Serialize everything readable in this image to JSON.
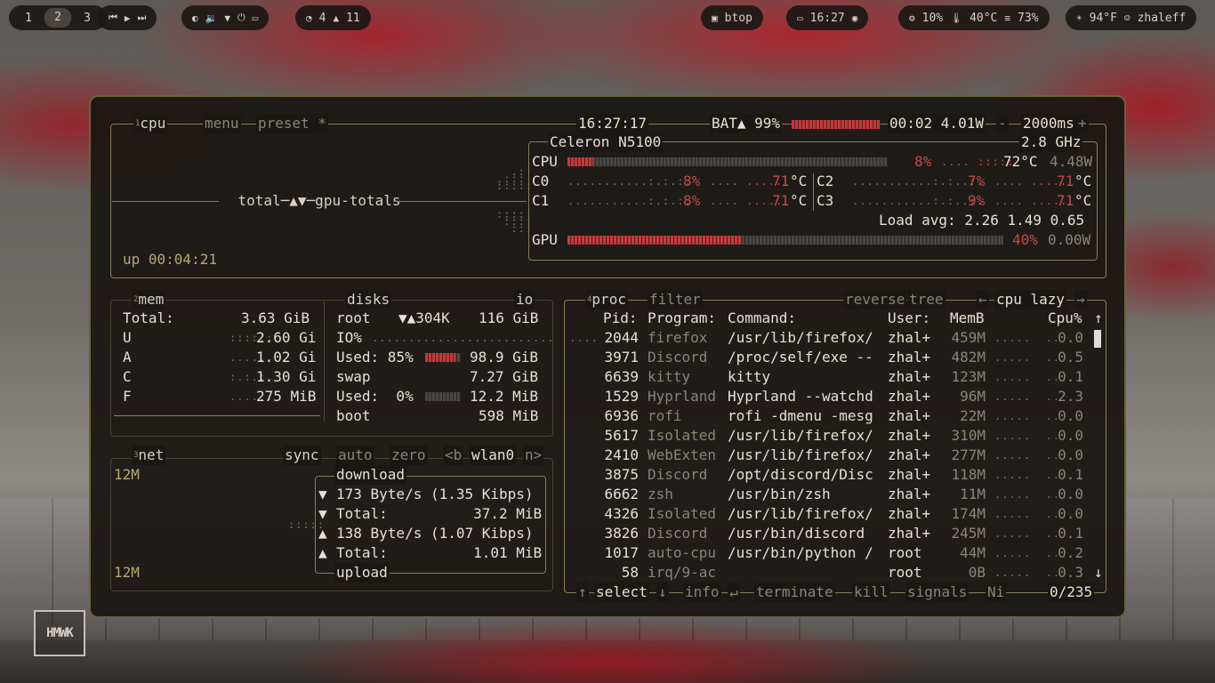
{
  "topbar": {
    "workspaces": [
      "1",
      "2",
      "3"
    ],
    "media_icons": [
      "prev-icon",
      "play-icon",
      "next-icon"
    ],
    "system_icons": [
      "brightness-icon",
      "volume-icon",
      "wifi-icon",
      "power-icon",
      "battery-icon"
    ],
    "counters": {
      "a": "4",
      "b": "11"
    },
    "window_title": "btop",
    "clock": "16:27",
    "cpu": "10%",
    "temp": "40°C",
    "disk": "73%",
    "weather": "94°F",
    "user": "zhaleff"
  },
  "cpu_box": {
    "title": "cpu",
    "num": "1",
    "menu": "menu",
    "preset": "preset *",
    "time": "16:27:17",
    "battery": "BAT▲ 99%",
    "battery_level": 0.99,
    "battery_time": "00:02 4.01W",
    "interval": "2000ms",
    "graph_label": "total─▲▼─gpu-totals",
    "uptime": "up 00:04:21",
    "model": "Celeron N5100",
    "freq": "2.8 GHz",
    "cpu_label": "CPU",
    "cpu_pct": "8%",
    "cpu_temp": "72°C",
    "cpu_power": "4.48W",
    "cpu_level": 0.08,
    "cores": [
      {
        "name": "C0",
        "pct": "8%",
        "temp": "71",
        "unit": "°C"
      },
      {
        "name": "C1",
        "pct": "8%",
        "temp": "71",
        "unit": "°C"
      },
      {
        "name": "C2",
        "pct": "7%",
        "temp": "71",
        "unit": "°C"
      },
      {
        "name": "C3",
        "pct": "9%",
        "temp": "71",
        "unit": "°C"
      }
    ],
    "load": "Load avg: 2.26 1.49 0.65",
    "gpu_label": "GPU",
    "gpu_pct": "40%",
    "gpu_power": "0.00W",
    "gpu_level": 0.4
  },
  "mem_box": {
    "title": "mem",
    "num": "2",
    "rows": [
      {
        "label": "Total:",
        "value": "3.63 GiB"
      },
      {
        "label": "U",
        "value": "2.60 Gi"
      },
      {
        "label": "A",
        "value": "1.02 Gi"
      },
      {
        "label": "C",
        "value": "1.30 Gi"
      },
      {
        "label": "F",
        "value": "275 MiB"
      }
    ],
    "disks_title": "disks",
    "io": "io",
    "disks": [
      {
        "name": "root",
        "io": "▼▲304K",
        "size": "116 GiB"
      },
      {
        "name": "swap",
        "size": "7.27 GiB"
      },
      {
        "name": "boot",
        "size": "598 MiB"
      }
    ],
    "io_pct": "IO%",
    "root_used": "Used: 85%",
    "root_used_level": 0.85,
    "root_used_size": "98.9 GiB",
    "swap_used": "Used:  0%",
    "swap_used_level": 0.0,
    "swap_used_size": "12.2 MiB"
  },
  "net_box": {
    "title": "net",
    "num": "3",
    "sync": "sync",
    "auto": "auto",
    "zero": "zero",
    "prev": "<b",
    "iface": "wlan0",
    "next": "n>",
    "scale_top": "12M",
    "scale_bottom": "12M",
    "download": "download",
    "upload": "upload",
    "rows": [
      {
        "arrow": "▼",
        "text": "173 Byte/s (1.35 Kibps)"
      },
      {
        "arrow": "▼",
        "text": "Total:          37.2 MiB"
      },
      {
        "arrow": "▲",
        "text": "138 Byte/s (1.07 Kibps)"
      },
      {
        "arrow": "▲",
        "text": "Total:          1.01 MiB"
      }
    ]
  },
  "proc_box": {
    "title": "proc",
    "num": "4",
    "filter": "filter",
    "reverse": "reverse",
    "tree": "tree",
    "sort": "cpu lazy",
    "headers": {
      "pid": "Pid:",
      "program": "Program:",
      "command": "Command:",
      "user": "User:",
      "mem": "MemB",
      "cpu": "Cpu%"
    },
    "rows": [
      {
        "pid": "2044",
        "program": "firefox",
        "command": "/usr/lib/firefox/",
        "user": "zhal+",
        "mem": "459M",
        "cpu": "0.0"
      },
      {
        "pid": "3971",
        "program": "Discord",
        "command": "/proc/self/exe --",
        "user": "zhal+",
        "mem": "482M",
        "cpu": "0.5"
      },
      {
        "pid": "6639",
        "program": "kitty",
        "command": "kitty",
        "user": "zhal+",
        "mem": "123M",
        "cpu": "0.1"
      },
      {
        "pid": "1529",
        "program": "Hyprland",
        "command": "Hyprland --watchd",
        "user": "zhal+",
        "mem": "96M",
        "cpu": "2.3"
      },
      {
        "pid": "6936",
        "program": "rofi",
        "command": "rofi -dmenu -mesg",
        "user": "zhal+",
        "mem": "22M",
        "cpu": "0.0"
      },
      {
        "pid": "5617",
        "program": "Isolated",
        "command": "/usr/lib/firefox/",
        "user": "zhal+",
        "mem": "310M",
        "cpu": "0.0"
      },
      {
        "pid": "2410",
        "program": "WebExten",
        "command": "/usr/lib/firefox/",
        "user": "zhal+",
        "mem": "277M",
        "cpu": "0.0"
      },
      {
        "pid": "3875",
        "program": "Discord",
        "command": "/opt/discord/Disc",
        "user": "zhal+",
        "mem": "118M",
        "cpu": "0.1"
      },
      {
        "pid": "6662",
        "program": "zsh",
        "command": "/usr/bin/zsh",
        "user": "zhal+",
        "mem": "11M",
        "cpu": "0.0"
      },
      {
        "pid": "4326",
        "program": "Isolated",
        "command": "/usr/lib/firefox/",
        "user": "zhal+",
        "mem": "174M",
        "cpu": "0.0"
      },
      {
        "pid": "3826",
        "program": "Discord",
        "command": "/usr/bin/discord",
        "user": "zhal+",
        "mem": "245M",
        "cpu": "0.1"
      },
      {
        "pid": "1017",
        "program": "auto-cpu",
        "command": "/usr/bin/python /",
        "user": "root",
        "mem": "44M",
        "cpu": "0.2"
      },
      {
        "pid": "58",
        "program": "irq/9-ac",
        "command": "",
        "user": "root",
        "mem": "0B",
        "cpu": "0.3"
      }
    ],
    "footer": {
      "select": "select",
      "info": "info",
      "terminate": "terminate",
      "kill": "kill",
      "signals": "signals",
      "ni": "Ni",
      "count": "0/235"
    }
  },
  "logo": "HMWK"
}
